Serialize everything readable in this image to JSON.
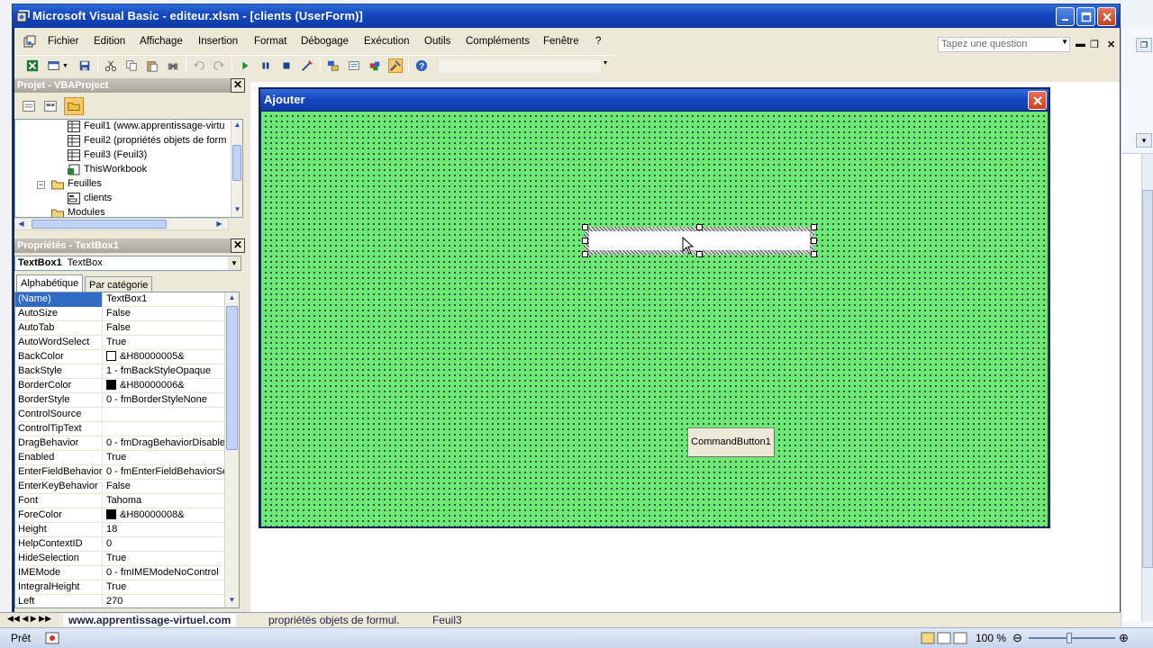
{
  "window": {
    "title": "Microsoft Visual Basic - editeur.xlsm - [clients (UserForm)]"
  },
  "menu": {
    "items": [
      "Fichier",
      "Edition",
      "Affichage",
      "Insertion",
      "Format",
      "Débogage",
      "Exécution",
      "Outils",
      "Compléments",
      "Fenêtre",
      "?"
    ],
    "help_placeholder": "Tapez une question"
  },
  "project_pane": {
    "title": "Projet - VBAProject",
    "tree": [
      {
        "label": "Feuil1 (www.apprentissage-virtu",
        "icon": "sheet-icon"
      },
      {
        "label": "Feuil2 (propriétés objets de form",
        "icon": "sheet-icon"
      },
      {
        "label": "Feuil3 (Feuil3)",
        "icon": "sheet-icon"
      },
      {
        "label": "ThisWorkbook",
        "icon": "workbook-icon"
      },
      {
        "label": "Feuilles",
        "icon": "folder-icon"
      },
      {
        "label": "clients",
        "icon": "userform-icon"
      },
      {
        "label": "Modules",
        "icon": "folder-icon"
      }
    ]
  },
  "properties_pane": {
    "title": "Propriétés - TextBox1",
    "object_name": "TextBox1",
    "object_type": "TextBox",
    "tabs": [
      "Alphabétique",
      "Par catégorie"
    ],
    "rows": [
      {
        "name": "(Name)",
        "value": "TextBox1"
      },
      {
        "name": "AutoSize",
        "value": "False"
      },
      {
        "name": "AutoTab",
        "value": "False"
      },
      {
        "name": "AutoWordSelect",
        "value": "True"
      },
      {
        "name": "BackColor",
        "value": "&H80000005&",
        "swatch": "#ffffff"
      },
      {
        "name": "BackStyle",
        "value": "1 - fmBackStyleOpaque"
      },
      {
        "name": "BorderColor",
        "value": "&H80000006&",
        "swatch": "#000000"
      },
      {
        "name": "BorderStyle",
        "value": "0 - fmBorderStyleNone"
      },
      {
        "name": "ControlSource",
        "value": ""
      },
      {
        "name": "ControlTipText",
        "value": ""
      },
      {
        "name": "DragBehavior",
        "value": "0 - fmDragBehaviorDisable"
      },
      {
        "name": "Enabled",
        "value": "True"
      },
      {
        "name": "EnterFieldBehavior",
        "value": "0 - fmEnterFieldBehaviorSe"
      },
      {
        "name": "EnterKeyBehavior",
        "value": "False"
      },
      {
        "name": "Font",
        "value": "Tahoma"
      },
      {
        "name": "ForeColor",
        "value": "&H80000008&",
        "swatch": "#000000"
      },
      {
        "name": "Height",
        "value": "18"
      },
      {
        "name": "HelpContextID",
        "value": "0"
      },
      {
        "name": "HideSelection",
        "value": "True"
      },
      {
        "name": "IMEMode",
        "value": "0 - fmIMEModeNoControl"
      },
      {
        "name": "IntegralHeight",
        "value": "True"
      },
      {
        "name": "Left",
        "value": "270"
      }
    ]
  },
  "userform": {
    "caption": "Ajouter",
    "button_caption": "CommandButton1",
    "back_color": "#6ee876"
  },
  "sheet_tabs": [
    "www.apprentissage-virtuel.com",
    "propriétés objets de formul.",
    "Feuil3"
  ],
  "status": {
    "ready": "Prêt",
    "zoom": "100 %"
  }
}
